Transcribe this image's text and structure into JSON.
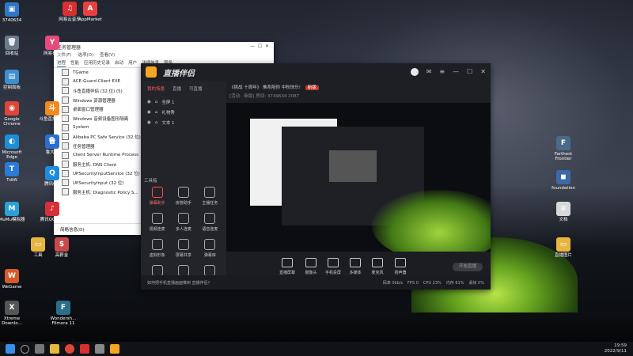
{
  "desktop": {
    "left_icons": [
      {
        "label": "3740634",
        "color": "#2f78c8",
        "glyph": "▣"
      },
      {
        "label": "回收站",
        "color": "#6b7b8c",
        "glyph": "🗑"
      },
      {
        "label": "控制面板",
        "color": "#3d8fd1",
        "glyph": "▤"
      },
      {
        "label": "Google Chrome",
        "color": "#e0453a",
        "glyph": "◉"
      },
      {
        "label": "Microsoft Edge",
        "color": "#1d8fd6",
        "glyph": "◐"
      },
      {
        "label": "TdiW",
        "color": "#2a7ad6",
        "glyph": "T"
      },
      {
        "label": "MuMu模拟器",
        "color": "#2a9fd8",
        "glyph": "M"
      },
      {
        "label": "WeGame",
        "color": "#d65a2a",
        "glyph": "W"
      },
      {
        "label": "Xtreme Downlo...",
        "color": "#555",
        "glyph": "X"
      }
    ],
    "second_col_icons": [
      {
        "label": "网易云音乐",
        "color": "#d83030",
        "glyph": "♫"
      },
      {
        "label": "AppMarket",
        "color": "#e84040",
        "glyph": "A"
      }
    ],
    "col2_icons": [
      {
        "label": "网易云音乐",
        "color": "#d83030",
        "glyph": "♫"
      },
      {
        "label": "网易有道",
        "color": "#e84a7c",
        "glyph": "Y"
      },
      {
        "label": "斗鱼直播伴侣",
        "color": "#f08a20",
        "glyph": "斗"
      },
      {
        "label": "鲁大师",
        "color": "#2a6fd0",
        "glyph": "鲁"
      },
      {
        "label": "腾讯QQ",
        "color": "#1d8ce0",
        "glyph": "Q"
      },
      {
        "label": "腾讯QQ旋律",
        "color": "#d6303a",
        "glyph": "♪"
      },
      {
        "label": "Wondersh... Filmora 11",
        "color": "#2a6f8a",
        "glyph": "F"
      },
      {
        "label": "工具",
        "color": "#e8b640",
        "glyph": "▭"
      },
      {
        "label": "高薪金",
        "color": "#c84a4a",
        "glyph": "$"
      }
    ],
    "right_icons": [
      {
        "label": "Farthest Frontier",
        "color": "#4a6a8a",
        "glyph": "F"
      },
      {
        "label": "foundation",
        "color": "#3a6aa8",
        "glyph": "◼"
      },
      {
        "label": "文档",
        "color": "#d8d8d8",
        "glyph": "≡"
      },
      {
        "label": "直播图片",
        "color": "#e8b640",
        "glyph": "▭"
      }
    ]
  },
  "task_manager": {
    "title": "任务管理器",
    "menu": [
      "文件(F)",
      "选项(O)",
      "查看(V)"
    ],
    "tabs": [
      "进程",
      "性能",
      "应用历史记录",
      "启动",
      "用户",
      "详细信息",
      "服务"
    ],
    "rows": [
      "TGame",
      "ACE-Guard Client EXE",
      "斗鱼直播伴侣 (32 位) (5)",
      "Windows 资源管理器",
      "桌面窗口管理器",
      "Windows 音频设备图形隔离",
      "System",
      "Alibaba PC Safe Service (32 位)",
      "任务管理器",
      "Client Server Runtime Process",
      "服务主机: DNS Client",
      "UPSecurityInputService (32 位)",
      "UPSecurityInput (32 位)",
      "服务主机: Diagnostic Policy S..."
    ],
    "footer": "简略信息(D)"
  },
  "live_companion": {
    "logo": "直播伴侣",
    "left_tabs": [
      "我的场景",
      "直播",
      "可直播"
    ],
    "scenes": [
      "全屏 1",
      "礼物秀",
      "文本 1"
    ],
    "tools_label": "工具箱",
    "tools": [
      "弹幕助手",
      "房管助手",
      "主播任务",
      "视频连麦",
      "多人连麦",
      "语音连麦",
      "虚拟形象",
      "屏幕共享",
      "弹幕库",
      "美颜",
      "直播截图",
      "更多"
    ],
    "info_title": "《挑战 十周年》 佛系陪你 中秋快乐!",
    "info_tag": "新版",
    "info_sub": "[活动 · 新版] 房间: 3749634   2087",
    "bottom_buttons": [
      "直播屏幕",
      "摄像头",
      "手机投屏",
      "多媒体",
      "麦克风",
      "扬声器"
    ],
    "go_live": "开始直播",
    "status_left": "如何把手机直播画面推到 直播伴侣?",
    "status_right": [
      "码率 0kb/s",
      "FPS 0",
      "CPU 23%",
      "内存 61%",
      "丢帧 0%"
    ]
  },
  "taskbar": {
    "time": "19:59",
    "date": "2022/9/11"
  }
}
